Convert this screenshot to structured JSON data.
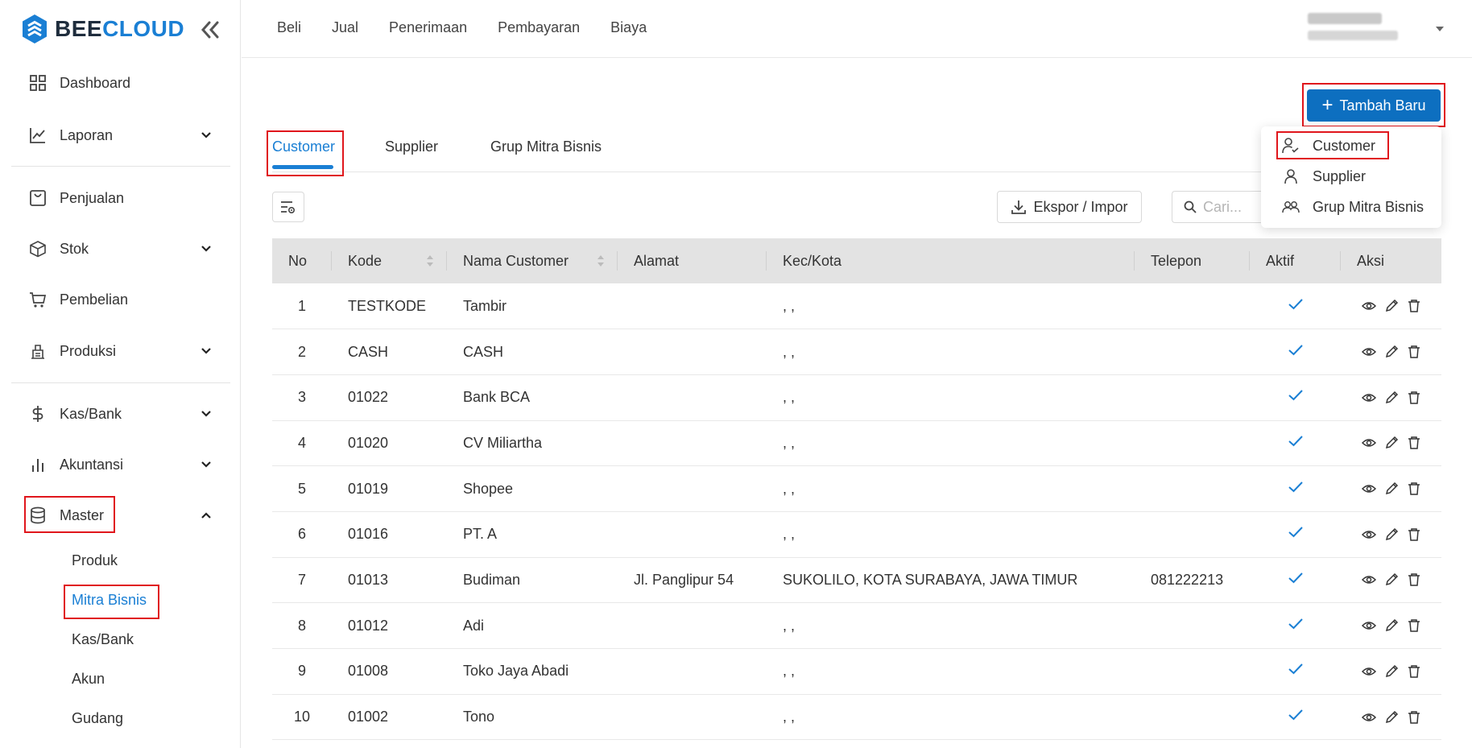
{
  "brand": {
    "part1": "BEE",
    "part2": "CLOUD",
    "accent": "#1a7fd4"
  },
  "sidebar": {
    "items": [
      {
        "label": "Dashboard",
        "icon": "dashboard-grid-icon"
      },
      {
        "label": "Laporan",
        "icon": "line-chart-icon",
        "expandable": true
      },
      {
        "label": "Penjualan",
        "icon": "shopping-bag-icon"
      },
      {
        "label": "Stok",
        "icon": "box-icon",
        "expandable": true
      },
      {
        "label": "Pembelian",
        "icon": "cart-icon"
      },
      {
        "label": "Produksi",
        "icon": "factory-icon",
        "expandable": true
      },
      {
        "label": "Kas/Bank",
        "icon": "dollar-icon",
        "expandable": true
      },
      {
        "label": "Akuntansi",
        "icon": "bar-chart-icon",
        "expandable": true
      },
      {
        "label": "Master",
        "icon": "database-icon",
        "expanded": true
      }
    ],
    "master_sub": [
      "Produk",
      "Mitra Bisnis",
      "Kas/Bank",
      "Akun",
      "Gudang"
    ],
    "active_sub": "Mitra Bisnis"
  },
  "topnav": [
    "Beli",
    "Jual",
    "Penerimaan",
    "Pembayaran",
    "Biaya"
  ],
  "main": {
    "add_button": "Tambah Baru",
    "tabs": [
      "Customer",
      "Supplier",
      "Grup Mitra Bisnis"
    ],
    "active_tab": "Customer",
    "dropdown": [
      "Customer",
      "Supplier",
      "Grup Mitra Bisnis"
    ],
    "export_button": "Ekspor / Impor",
    "search_placeholder": "Cari..."
  },
  "table": {
    "columns": [
      "No",
      "Kode",
      "Nama Customer",
      "Alamat",
      "Kec/Kota",
      "Telepon",
      "Aktif",
      "Aksi"
    ],
    "rows": [
      {
        "no": "1",
        "kode": "TESTKODE",
        "nama": "Tambir",
        "alamat": "",
        "kota": ", ,",
        "telepon": ""
      },
      {
        "no": "2",
        "kode": "CASH",
        "nama": "CASH",
        "alamat": "",
        "kota": ", ,",
        "telepon": ""
      },
      {
        "no": "3",
        "kode": "01022",
        "nama": "Bank BCA",
        "alamat": "",
        "kota": ", ,",
        "telepon": ""
      },
      {
        "no": "4",
        "kode": "01020",
        "nama": "CV Miliartha",
        "alamat": "",
        "kota": ", ,",
        "telepon": ""
      },
      {
        "no": "5",
        "kode": "01019",
        "nama": "Shopee",
        "alamat": "",
        "kota": ", ,",
        "telepon": ""
      },
      {
        "no": "6",
        "kode": "01016",
        "nama": "PT. A",
        "alamat": "",
        "kota": ", ,",
        "telepon": ""
      },
      {
        "no": "7",
        "kode": "01013",
        "nama": "Budiman",
        "alamat": "Jl. Panglipur 54",
        "kota": "SUKOLILO, KOTA SURABAYA, JAWA TIMUR",
        "telepon": "081222213"
      },
      {
        "no": "8",
        "kode": "01012",
        "nama": "Adi",
        "alamat": "",
        "kota": ", ,",
        "telepon": ""
      },
      {
        "no": "9",
        "kode": "01008",
        "nama": "Toko Jaya Abadi",
        "alamat": "",
        "kota": ", ,",
        "telepon": ""
      },
      {
        "no": "10",
        "kode": "01002",
        "nama": "Tono",
        "alamat": "",
        "kota": ", ,",
        "telepon": ""
      }
    ]
  },
  "colors": {
    "primary": "#0d6fc0",
    "link": "#1a7fd4",
    "highlight_box": "#e0161c"
  }
}
